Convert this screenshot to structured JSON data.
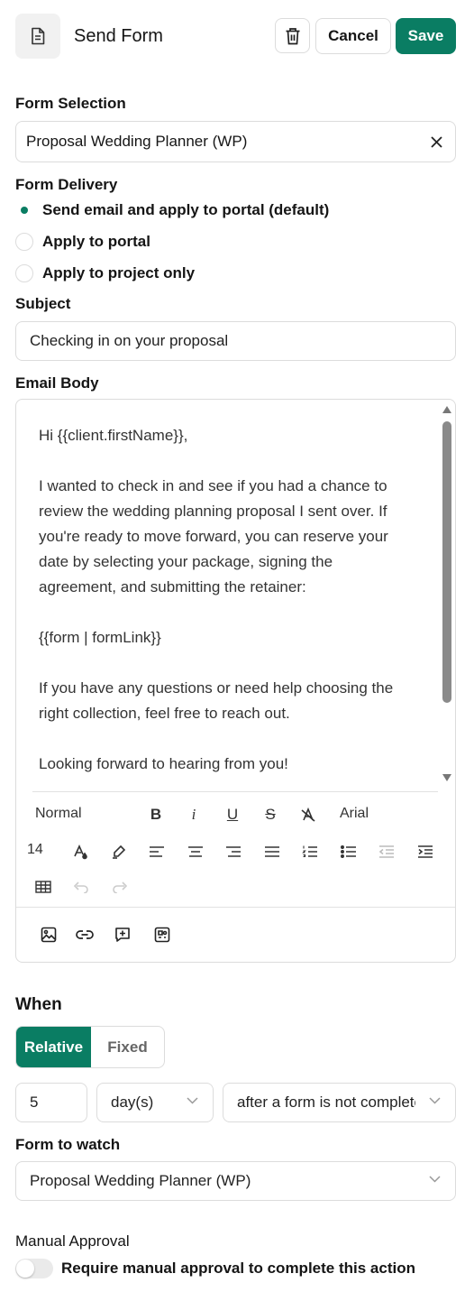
{
  "header": {
    "title": "Send Form",
    "cancel_label": "Cancel",
    "save_label": "Save"
  },
  "form_selection": {
    "label": "Form Selection",
    "value": "Proposal Wedding Planner (WP)"
  },
  "form_delivery": {
    "label": "Form Delivery",
    "options": [
      {
        "label": "Send email and apply to portal (default)",
        "selected": true
      },
      {
        "label": "Apply to portal",
        "selected": false
      },
      {
        "label": "Apply to project only",
        "selected": false
      }
    ]
  },
  "subject": {
    "label": "Subject",
    "value": "Checking in on your proposal"
  },
  "email_body": {
    "label": "Email Body",
    "lines": [
      "Hi {{client.firstName}},",
      "",
      "I wanted to check in and see if you had a chance to",
      "review the wedding planning proposal I sent over. If",
      "you're ready to move forward, you can reserve your",
      "date by selecting your package, signing the",
      "agreement, and submitting the retainer:",
      "",
      "{{form | formLink}}",
      "",
      "If you have any questions or need help choosing the",
      "right collection, feel free to reach out.",
      "",
      "Looking forward to hearing from you!"
    ],
    "toolbar": {
      "style": "Normal",
      "font": "Arial",
      "size": "14"
    }
  },
  "when": {
    "label": "When",
    "tabs": [
      {
        "label": "Relative",
        "active": true
      },
      {
        "label": "Fixed",
        "active": false
      }
    ],
    "amount": "5",
    "unit": "day(s)",
    "condition": "after a form is not completed"
  },
  "form_to_watch": {
    "label": "Form to watch",
    "value": "Proposal Wedding Planner (WP)"
  },
  "manual_approval": {
    "label": "Manual Approval",
    "toggle_label": "Require manual approval to complete this action",
    "enabled": false
  },
  "colors": {
    "accent": "#0a7d63",
    "border": "#dcdcdc"
  }
}
